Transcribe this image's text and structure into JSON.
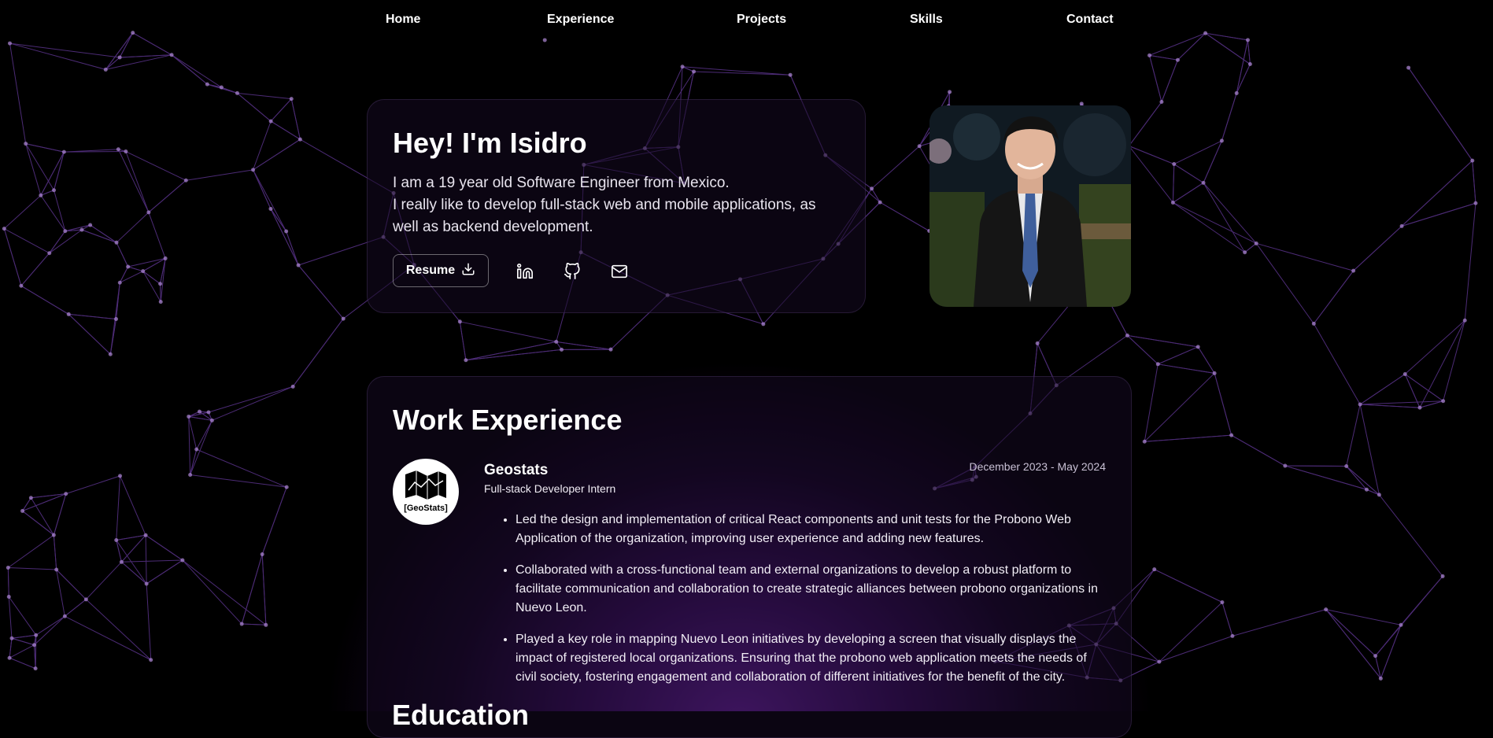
{
  "nav": {
    "items": [
      {
        "label": "Home"
      },
      {
        "label": "Experience"
      },
      {
        "label": "Projects"
      },
      {
        "label": "Skills"
      },
      {
        "label": "Contact"
      }
    ]
  },
  "hero": {
    "title": "Hey! I'm Isidro",
    "intro_line1": "I am a 19 year old Software Engineer from Mexico.",
    "intro_line2": "I really like to develop full-stack web and mobile applications, as",
    "intro_line3": "well as backend development.",
    "resume_label": "Resume",
    "icons": [
      "linkedin-icon",
      "github-icon",
      "mail-icon"
    ]
  },
  "work": {
    "title": "Work Experience",
    "jobs": [
      {
        "logo_text": "[GeoStats]",
        "company": "Geostats",
        "role": "Full-stack Developer Intern",
        "dates": "December 2023 - May 2024",
        "bullets": [
          "Led the design and implementation of critical React components and unit tests for the Probono Web Application of the organization, improving user experience and adding new features.",
          "Collaborated with a cross-functional team and external organizations to develop a robust platform to facilitate communication and collaboration to create strategic alliances between probono organizations in Nuevo Leon.",
          "Played a key role in mapping Nuevo Leon initiatives by developing a screen that visually displays the impact of registered local organizations. Ensuring that the probono web application meets the needs of civil society, fostering engagement and collaboration of different initiatives for the benefit of the city."
        ]
      }
    ]
  },
  "education": {
    "title": "Education"
  },
  "colors": {
    "accent": "#7b2cbf",
    "network_line": "#8a4fd6",
    "background": "#000000"
  }
}
